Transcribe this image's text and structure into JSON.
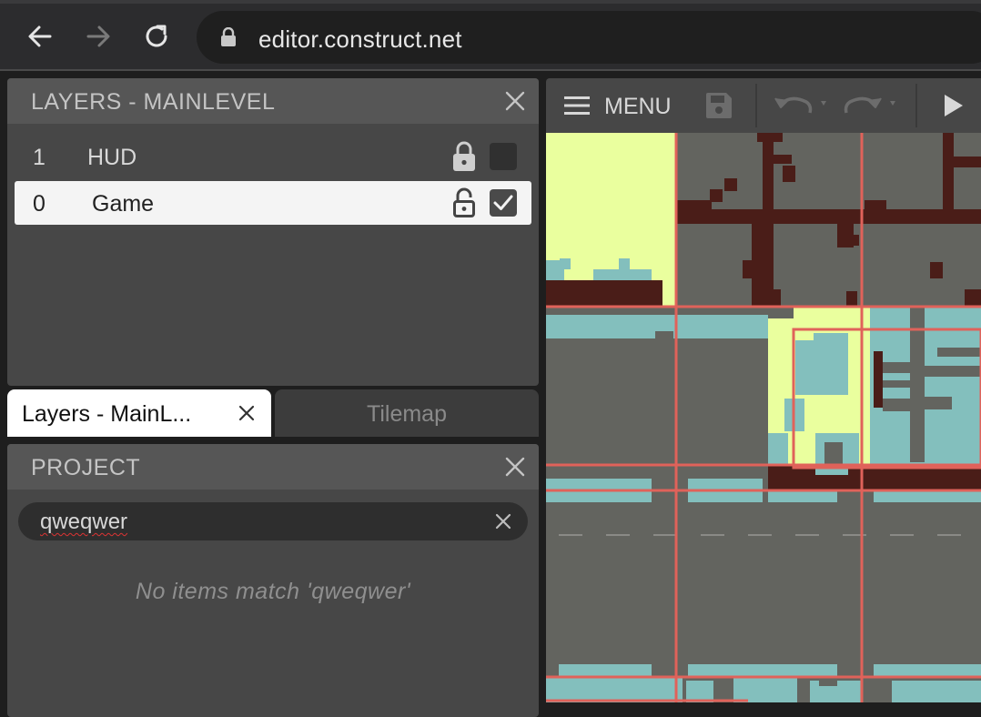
{
  "browser": {
    "url": "editor.construct.net",
    "back_icon": "arrow-left-icon",
    "forward_icon": "arrow-right-icon",
    "reload_icon": "reload-icon"
  },
  "layers_panel": {
    "title": "LAYERS - MAINLEVEL",
    "layers": [
      {
        "index": "1",
        "name": "HUD",
        "locked": true,
        "visible": false,
        "selected": false
      },
      {
        "index": "0",
        "name": "Game",
        "locked": false,
        "visible": true,
        "selected": true
      }
    ]
  },
  "tabs": [
    {
      "label": "Layers - MainL...",
      "active": true
    },
    {
      "label": "Tilemap",
      "active": false
    }
  ],
  "project_panel": {
    "title": "PROJECT",
    "search_value": "qweqwer",
    "empty_message": "No items match 'qweqwer'"
  },
  "toolbar": {
    "menu_label": "MENU"
  },
  "colors": {
    "panel_bg": "#474747",
    "header_bg": "#565656",
    "grid_line": "#e0625a",
    "tile_yellow": "#eaff9e",
    "tile_teal": "#83bfbd",
    "tile_dark": "#4a1d18",
    "tile_stone": "#63645f"
  }
}
